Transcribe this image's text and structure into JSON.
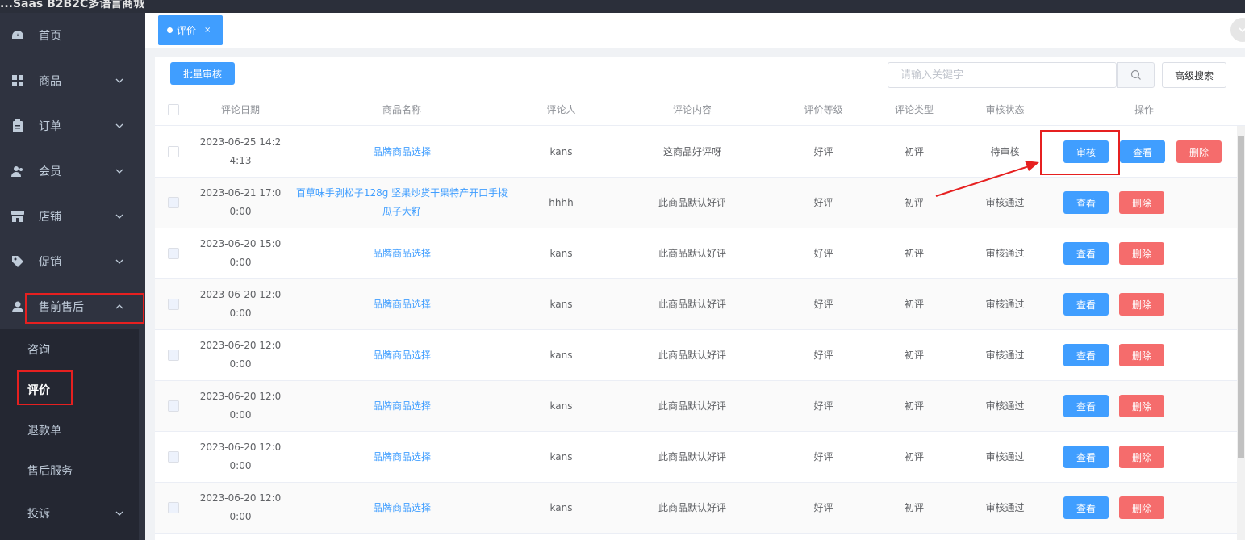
{
  "app": {
    "title": "...Saas B2B2C多语言商城"
  },
  "sidebar": {
    "items": [
      {
        "label": "首页",
        "icon": "dashboard-icon"
      },
      {
        "label": "商品",
        "icon": "grid-icon"
      },
      {
        "label": "订单",
        "icon": "clipboard-icon"
      },
      {
        "label": "会员",
        "icon": "users-icon"
      },
      {
        "label": "店铺",
        "icon": "store-icon"
      },
      {
        "label": "促销",
        "icon": "tag-icon"
      },
      {
        "label": "售前售后",
        "icon": "user-icon"
      }
    ],
    "submenu": [
      {
        "label": "咨询"
      },
      {
        "label": "评价"
      },
      {
        "label": "退款单"
      },
      {
        "label": "售后服务"
      },
      {
        "label": "投诉"
      }
    ]
  },
  "tabs": [
    {
      "label": "评价",
      "close": "×"
    }
  ],
  "toolbar": {
    "batch_label": "批量审核",
    "search_placeholder": "请输入关键字",
    "advanced_label": "高级搜索"
  },
  "table": {
    "headers": [
      "评论日期",
      "商品名称",
      "评论人",
      "评论内容",
      "评价等级",
      "评论类型",
      "审核状态",
      "操作"
    ],
    "rows": [
      {
        "date_line1": "2023-06-25 14:2",
        "date_line2": "4:13",
        "product": "品牌商品选择",
        "product2": "",
        "reviewer": "kans",
        "content": "这商品好评呀",
        "level": "好评",
        "type": "初评",
        "status": "待审核",
        "actions": [
          "审核",
          "查看",
          "删除"
        ]
      },
      {
        "date_line1": "2023-06-21 17:0",
        "date_line2": "0:00",
        "product": "百草味手剥松子128g 坚果炒货干果特产开口手拨",
        "product2": "瓜子大籽",
        "reviewer": "hhhh",
        "content": "此商品默认好评",
        "level": "好评",
        "type": "初评",
        "status": "审核通过",
        "actions": [
          "查看",
          "删除"
        ]
      },
      {
        "date_line1": "2023-06-20 15:0",
        "date_line2": "0:00",
        "product": "品牌商品选择",
        "product2": "",
        "reviewer": "kans",
        "content": "此商品默认好评",
        "level": "好评",
        "type": "初评",
        "status": "审核通过",
        "actions": [
          "查看",
          "删除"
        ]
      },
      {
        "date_line1": "2023-06-20 12:0",
        "date_line2": "0:00",
        "product": "品牌商品选择",
        "product2": "",
        "reviewer": "kans",
        "content": "此商品默认好评",
        "level": "好评",
        "type": "初评",
        "status": "审核通过",
        "actions": [
          "查看",
          "删除"
        ]
      },
      {
        "date_line1": "2023-06-20 12:0",
        "date_line2": "0:00",
        "product": "品牌商品选择",
        "product2": "",
        "reviewer": "kans",
        "content": "此商品默认好评",
        "level": "好评",
        "type": "初评",
        "status": "审核通过",
        "actions": [
          "查看",
          "删除"
        ]
      },
      {
        "date_line1": "2023-06-20 12:0",
        "date_line2": "0:00",
        "product": "品牌商品选择",
        "product2": "",
        "reviewer": "kans",
        "content": "此商品默认好评",
        "level": "好评",
        "type": "初评",
        "status": "审核通过",
        "actions": [
          "查看",
          "删除"
        ]
      },
      {
        "date_line1": "2023-06-20 12:0",
        "date_line2": "0:00",
        "product": "品牌商品选择",
        "product2": "",
        "reviewer": "kans",
        "content": "此商品默认好评",
        "level": "好评",
        "type": "初评",
        "status": "审核通过",
        "actions": [
          "查看",
          "删除"
        ]
      },
      {
        "date_line1": "2023-06-20 12:0",
        "date_line2": "0:00",
        "product": "品牌商品选择",
        "product2": "",
        "reviewer": "kans",
        "content": "此商品默认好评",
        "level": "好评",
        "type": "初评",
        "status": "审核通过",
        "actions": [
          "查看",
          "删除"
        ]
      }
    ]
  },
  "colors": {
    "primary": "#409eff",
    "danger": "#f56c6c",
    "sidebar_bg": "#2f3340",
    "annotation_red": "#e62020"
  }
}
